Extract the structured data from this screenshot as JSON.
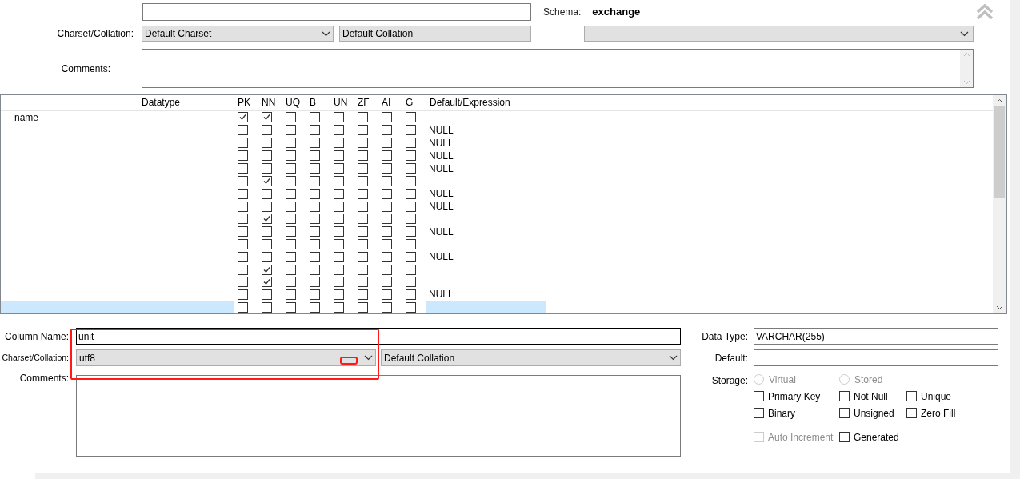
{
  "table_header": {
    "schema_label": "Schema:",
    "schema": "exchange",
    "charset_label": "Charset/Collation:",
    "charset": "Default Charset",
    "collation": "Default Collation",
    "comments_label": "Comments:"
  },
  "grid": {
    "columns": [
      {
        "label": "Datatype"
      },
      {
        "label": "PK"
      },
      {
        "label": "NN"
      },
      {
        "label": "UQ"
      },
      {
        "label": "B"
      },
      {
        "label": "UN"
      },
      {
        "label": "ZF"
      },
      {
        "label": "AI"
      },
      {
        "label": "G"
      },
      {
        "label": "Default/Expression"
      }
    ],
    "rows": [
      {
        "name": "name",
        "selected": false,
        "flags": [
          true,
          true,
          false,
          false,
          false,
          false,
          false,
          false
        ]
      },
      {
        "selected": false,
        "flags": [
          false,
          false,
          false,
          false,
          false,
          false,
          false,
          false
        ],
        "default": "NULL"
      },
      {
        "selected": false,
        "flags": [
          false,
          false,
          false,
          false,
          false,
          false,
          false,
          false
        ],
        "default": "NULL"
      },
      {
        "selected": false,
        "flags": [
          false,
          false,
          false,
          false,
          false,
          false,
          false,
          false
        ],
        "default": "NULL"
      },
      {
        "selected": false,
        "flags": [
          false,
          false,
          false,
          false,
          false,
          false,
          false,
          false
        ],
        "default": "NULL"
      },
      {
        "selected": false,
        "flags": [
          false,
          true,
          false,
          false,
          false,
          false,
          false,
          false
        ]
      },
      {
        "selected": false,
        "flags": [
          false,
          false,
          false,
          false,
          false,
          false,
          false,
          false
        ],
        "default": "NULL"
      },
      {
        "selected": false,
        "flags": [
          false,
          false,
          false,
          false,
          false,
          false,
          false,
          false
        ],
        "default": "NULL"
      },
      {
        "selected": false,
        "flags": [
          false,
          true,
          false,
          false,
          false,
          false,
          false,
          false
        ]
      },
      {
        "selected": false,
        "flags": [
          false,
          false,
          false,
          false,
          false,
          false,
          false,
          false
        ],
        "default": "NULL"
      },
      {
        "selected": false,
        "flags": [
          false,
          false,
          false,
          false,
          false,
          false,
          false,
          false
        ]
      },
      {
        "selected": false,
        "flags": [
          false,
          false,
          false,
          false,
          false,
          false,
          false,
          false
        ],
        "default": "NULL"
      },
      {
        "selected": false,
        "flags": [
          false,
          true,
          false,
          false,
          false,
          false,
          false,
          false
        ]
      },
      {
        "selected": false,
        "flags": [
          false,
          true,
          false,
          false,
          false,
          false,
          false,
          false
        ]
      },
      {
        "selected": false,
        "flags": [
          false,
          false,
          false,
          false,
          false,
          false,
          false,
          false
        ],
        "default": "NULL"
      },
      {
        "selected": true,
        "flags": [
          false,
          false,
          false,
          false,
          false,
          false,
          false,
          false
        ]
      }
    ]
  },
  "column_details": {
    "name_label": "Column Name:",
    "name": "unit",
    "charset_label": "Charset/Collation:",
    "charset": "utf8",
    "collation": "Default Collation",
    "comments_label": "Comments:",
    "type_label": "Data Type:",
    "type": "VARCHAR(255)",
    "default_label": "Default:",
    "storage_label": "Storage:",
    "storage": [
      {
        "label": "Virtual",
        "selected": false,
        "disabled": true
      },
      {
        "label": "Stored",
        "selected": false,
        "disabled": true
      }
    ],
    "options": [
      {
        "label": "Primary Key",
        "checked": false,
        "disabled": false
      },
      {
        "label": "Not Null",
        "checked": false,
        "disabled": false
      },
      {
        "label": "Unique",
        "checked": false,
        "disabled": false
      },
      {
        "label": "Binary",
        "checked": false,
        "disabled": false
      },
      {
        "label": "Unsigned",
        "checked": false,
        "disabled": false
      },
      {
        "label": "Zero Fill",
        "checked": false,
        "disabled": false
      },
      {
        "label": "Auto Increment",
        "checked": false,
        "disabled": true
      },
      {
        "label": "Generated",
        "checked": false,
        "disabled": false
      }
    ]
  }
}
